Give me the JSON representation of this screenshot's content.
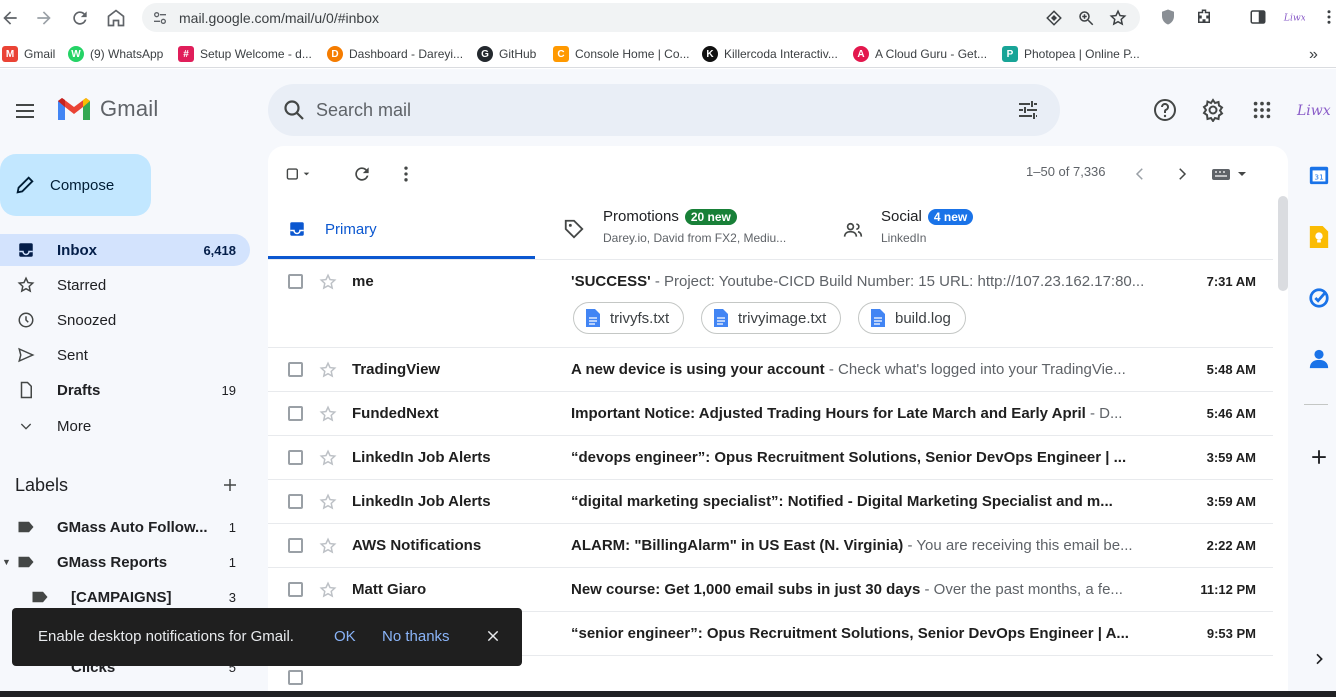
{
  "browser": {
    "url": "mail.google.com/mail/u/0/#inbox",
    "bookmarks": [
      {
        "label": "Gmail",
        "color": "#ea4335",
        "glyph": "M"
      },
      {
        "label": "(9) WhatsApp",
        "color": "#25d366",
        "glyph": "W"
      },
      {
        "label": "Setup Welcome - d...",
        "color": "#e01e5a",
        "glyph": "#"
      },
      {
        "label": "Dashboard - Dareyi...",
        "color": "#f57c00",
        "glyph": "D"
      },
      {
        "label": "GitHub",
        "color": "#24292e",
        "glyph": "G"
      },
      {
        "label": "Console Home | Co...",
        "color": "#ff9900",
        "glyph": "C"
      },
      {
        "label": "Killercoda Interactiv...",
        "color": "#111111",
        "glyph": "K"
      },
      {
        "label": "A Cloud Guru - Get...",
        "color": "#e3174d",
        "glyph": "A"
      },
      {
        "label": "Photopea | Online P...",
        "color": "#18a497",
        "glyph": "P"
      }
    ],
    "more_bookmarks": "»"
  },
  "gmail": {
    "logo_text": "Gmail",
    "search_placeholder": "Search mail",
    "compose_label": "Compose",
    "nav": [
      {
        "label": "Inbox",
        "count": "6,418",
        "icon": "inbox-icon",
        "active": true
      },
      {
        "label": "Starred",
        "count": "",
        "icon": "star-icon",
        "active": false
      },
      {
        "label": "Snoozed",
        "count": "",
        "icon": "clock-icon",
        "active": false
      },
      {
        "label": "Sent",
        "count": "",
        "icon": "send-icon",
        "active": false
      },
      {
        "label": "Drafts",
        "count": "19",
        "icon": "draft-icon",
        "active": false
      },
      {
        "label": "More",
        "count": "",
        "icon": "chevron-down-icon",
        "active": false
      }
    ],
    "labels_title": "Labels",
    "labels": [
      {
        "label": "GMass Auto Follow...",
        "count": "1"
      },
      {
        "label": "GMass Reports",
        "count": "1"
      },
      {
        "label": "[CAMPAIGNS]",
        "count": "3"
      },
      {
        "label": "Clicks",
        "count": "5"
      }
    ],
    "pager": "1–50 of 7,336",
    "tabs": {
      "primary": "Primary",
      "promotions": {
        "label": "Promotions",
        "badge": "20 new",
        "sub": "Darey.io, David from FX2, Mediu..."
      },
      "social": {
        "label": "Social",
        "badge": "4 new",
        "sub": "LinkedIn"
      }
    },
    "emails": [
      {
        "sender": "me",
        "subject": "'SUCCESS'",
        "snippet": " - Project: Youtube-CICD Build Number: 15 URL: http://107.23.162.17:80...",
        "time": "7:31 AM"
      },
      {
        "sender": "TradingView",
        "subject": "A new device is using your account",
        "snippet": " - Check what's logged into your TradingVie...",
        "time": "5:48 AM"
      },
      {
        "sender": "FundedNext",
        "subject": "Important Notice: Adjusted Trading Hours for Late March and Early April",
        "snippet": " - D...",
        "time": "5:46 AM"
      },
      {
        "sender": "LinkedIn Job Alerts",
        "subject": "“devops engineer”: Opus Recruitment Solutions, Senior DevOps Engineer | ...",
        "snippet": "",
        "time": "3:59 AM"
      },
      {
        "sender": "LinkedIn Job Alerts",
        "subject": "“digital marketing specialist”: Notified - Digital Marketing Specialist and m...",
        "snippet": "",
        "time": "3:59 AM"
      },
      {
        "sender": "AWS Notifications",
        "subject": "ALARM: \"BillingAlarm\" in US East (N. Virginia)",
        "snippet": " - You are receiving this email be...",
        "time": "2:22 AM"
      },
      {
        "sender": "Matt Giaro",
        "subject": "New course: Get 1,000 email subs in just 30 days",
        "snippet": " - Over the past months, a fe...",
        "time": "11:12 PM"
      },
      {
        "sender": "",
        "subject": "“senior engineer”: Opus Recruitment Solutions, Senior DevOps Engineer | A...",
        "snippet": "",
        "time": "9:53 PM"
      }
    ],
    "attachments": [
      "trivyfs.txt",
      "trivyimage.txt",
      "build.log"
    ],
    "snackbar": {
      "text": "Enable desktop notifications for Gmail.",
      "ok": "OK",
      "no": "No thanks"
    },
    "colors": {
      "accent": "#0b57d0",
      "promo_badge": "#188038",
      "social_badge": "#1a73e8",
      "active_nav": "#d3e3fd",
      "compose": "#c2e7ff"
    }
  }
}
